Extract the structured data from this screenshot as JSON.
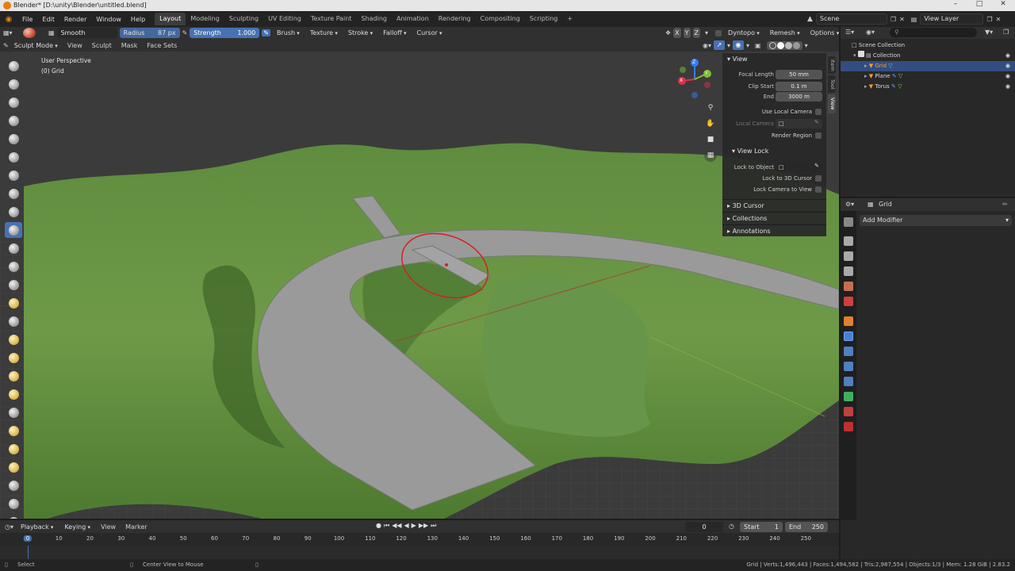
{
  "title_bar": {
    "text": "Blender* [D:\\unity\\Blender\\untitled.blend]"
  },
  "menu": {
    "items": [
      "File",
      "Edit",
      "Render",
      "Window",
      "Help"
    ],
    "workspaces": [
      "Layout",
      "Modeling",
      "Sculpting",
      "UV Editing",
      "Texture Paint",
      "Shading",
      "Animation",
      "Rendering",
      "Compositing",
      "Scripting"
    ],
    "active_workspace": "Layout",
    "add_tab": "+",
    "scene": "Scene",
    "view_layer": "View Layer"
  },
  "tool_header": {
    "brush_name": "Smooth",
    "radius_label": "Radius",
    "radius_value": "87 px",
    "strength_label": "Strength",
    "strength_value": "1.000",
    "brush_menu": "Brush",
    "texture_menu": "Texture",
    "stroke_menu": "Stroke",
    "falloff_menu": "Falloff",
    "cursor_menu": "Cursor",
    "axis_x": "X",
    "axis_y": "Y",
    "axis_z": "Z",
    "dyntopo": "Dyntopo",
    "remesh": "Remesh",
    "options": "Options"
  },
  "viewport_header": {
    "mode": "Sculpt Mode",
    "menus": [
      "View",
      "Sculpt",
      "Mask",
      "Face Sets"
    ]
  },
  "viewport": {
    "perspective": "User Perspective",
    "object_info": "(0) Grid"
  },
  "n_panel": {
    "tabs": [
      "Item",
      "Tool",
      "View"
    ],
    "active_tab": "View",
    "view_section": "View",
    "focal_length_label": "Focal Length",
    "focal_length": "50 mm",
    "clip_start_label": "Clip Start",
    "clip_start": "0.1 m",
    "end_label": "End",
    "end": "3000 m",
    "use_local_camera": "Use Local Camera",
    "local_camera": "Local Camera",
    "render_region": "Render Region",
    "view_lock_section": "View Lock",
    "lock_to_object": "Lock to Object",
    "lock_to_3d_cursor": "Lock to 3D Cursor",
    "lock_camera_to_view": "Lock Camera to View",
    "cursor_section": "3D Cursor",
    "collections_section": "Collections",
    "annotations_section": "Annotations"
  },
  "gizmo": {
    "x": "X",
    "y": "Y",
    "z": "Z"
  },
  "outliner": {
    "root": "Scene Collection",
    "collection": "Collection",
    "objects": [
      {
        "name": "Grid",
        "selected": true
      },
      {
        "name": "Plane",
        "selected": false
      },
      {
        "name": "Torus",
        "selected": false
      }
    ]
  },
  "properties": {
    "object_name": "Grid",
    "add_modifier": "Add Modifier"
  },
  "timeline": {
    "menus": [
      "Playback",
      "Keying",
      "View",
      "Marker"
    ],
    "current_frame": "0",
    "start_label": "Start",
    "start": "1",
    "end_label": "End",
    "end": "250",
    "ticks": [
      "0",
      "10",
      "20",
      "30",
      "40",
      "50",
      "60",
      "70",
      "80",
      "90",
      "100",
      "110",
      "120",
      "130",
      "140",
      "150",
      "160",
      "170",
      "180",
      "190",
      "200",
      "210",
      "220",
      "230",
      "240",
      "250"
    ]
  },
  "status_bar": {
    "select": "Select",
    "center_view": "Center View to Mouse",
    "stats": "Grid | Verts:1,496,443 | Faces:1,494,582 | Tris:2,987,554 | Objects:1/3 | Mem: 1.28 GiB | 2.83.2"
  },
  "colors": {
    "accent": "#4772b3",
    "terrain": "#6e9a48",
    "road": "#9a9a9a",
    "brush_circle": "#d42020",
    "background": "#3d3d3d"
  }
}
